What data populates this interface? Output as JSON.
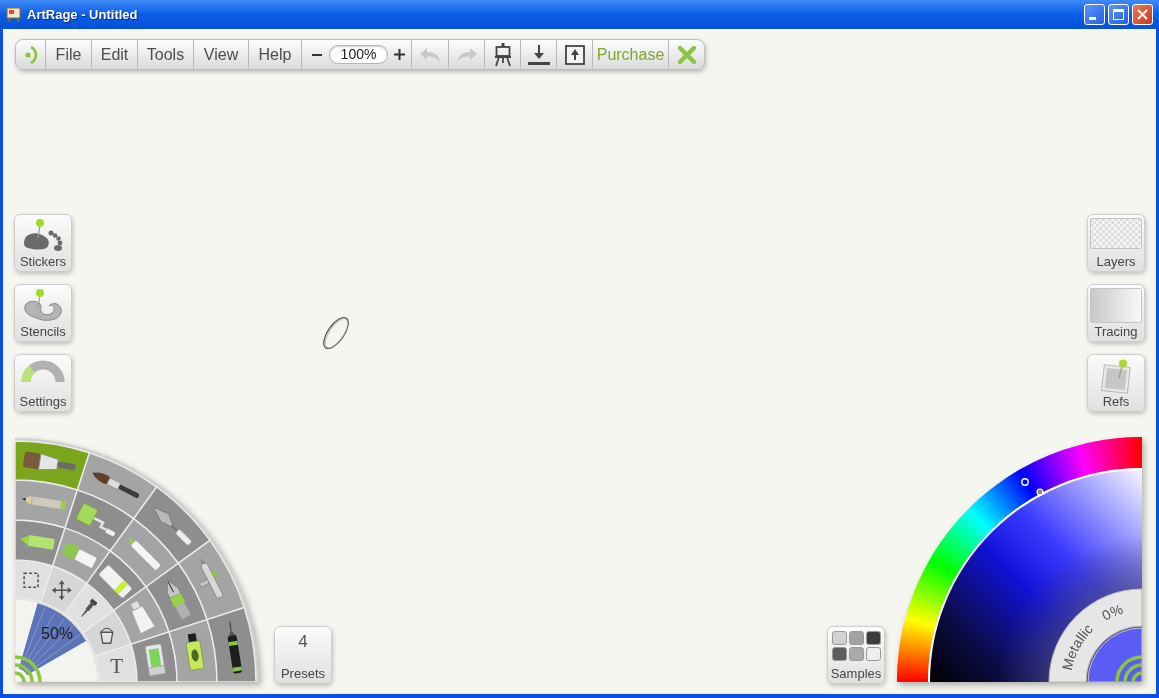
{
  "window": {
    "title": "ArtRage - Untitled"
  },
  "toolbar": {
    "menus": [
      "File",
      "Edit",
      "Tools",
      "View",
      "Help"
    ],
    "zoom": "100%",
    "undo": {
      "disabled": true
    },
    "redo": {
      "disabled": true
    },
    "purchase": "Purchase"
  },
  "left_panels": [
    {
      "kind": "stickers",
      "label": "Stickers"
    },
    {
      "kind": "stencils",
      "label": "Stencils"
    },
    {
      "kind": "settings",
      "label": "Settings"
    }
  ],
  "right_panels": [
    {
      "kind": "layers",
      "label": "Layers"
    },
    {
      "kind": "tracing",
      "label": "Tracing"
    },
    {
      "kind": "refs",
      "label": "Refs"
    }
  ],
  "tool_wheel": {
    "brush_size": "50%",
    "rings": [
      {
        "tools": [
          {
            "kind": "select",
            "selected": false
          },
          {
            "kind": "transform",
            "selected": false
          },
          {
            "kind": "eyedropper",
            "selected": false
          },
          {
            "kind": "fill",
            "selected": false
          },
          {
            "kind": "text",
            "label": "T",
            "selected": false
          }
        ]
      },
      {
        "tools": [
          {
            "kind": "oil-pastel",
            "selected": false
          },
          {
            "kind": "chalk",
            "selected": false
          },
          {
            "kind": "eraser",
            "selected": false
          },
          {
            "kind": "paint-tube",
            "selected": false
          },
          {
            "kind": "glitter",
            "selected": false
          }
        ]
      },
      {
        "tools": [
          {
            "kind": "pencil",
            "selected": false
          },
          {
            "kind": "paint-roller",
            "selected": false
          },
          {
            "kind": "felt-pen",
            "selected": false
          },
          {
            "kind": "ink-pen",
            "selected": false
          },
          {
            "kind": "sticker-spray",
            "selected": false
          }
        ]
      },
      {
        "tools": [
          {
            "kind": "flat-brush",
            "selected": true
          },
          {
            "kind": "round-brush",
            "selected": false
          },
          {
            "kind": "palette-knife",
            "selected": false
          },
          {
            "kind": "airbrush",
            "selected": false
          },
          {
            "kind": "technical-pen",
            "selected": false
          }
        ]
      }
    ]
  },
  "presets": {
    "count": "4",
    "label": "Presets"
  },
  "samples": {
    "label": "Samples",
    "swatches": [
      {
        "color": "#d2d2d2"
      },
      {
        "color": "#a2a2a2"
      },
      {
        "color": "#3c3c3c"
      },
      {
        "color": "#5c5c5c"
      },
      {
        "color": "#aaaaaa"
      },
      {
        "color": "#eeeeee"
      }
    ]
  },
  "color_picker": {
    "metallic": {
      "label": "Metallic",
      "value": "0%"
    }
  }
}
